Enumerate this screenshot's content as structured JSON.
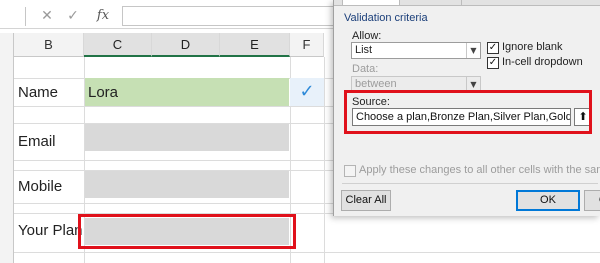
{
  "formula_bar": {
    "cancel_icon": "close-icon",
    "cancel_glyph": "✕",
    "enter_glyph": "✓",
    "fx_label": "fx"
  },
  "columns": [
    "B",
    "C",
    "D",
    "E",
    "F"
  ],
  "rows": {
    "name_label": "Name",
    "name_value": "Lora",
    "email_label": "Email",
    "mobile_label": "Mobile",
    "plan_label": "Your Plan"
  },
  "cell_check_glyph": "✓",
  "dialog": {
    "section_title": "Validation criteria",
    "allow_label": "Allow:",
    "allow_value": "List",
    "data_label": "Data:",
    "data_value": "between",
    "ignore_blank_label": "Ignore blank",
    "ignore_blank_checked": true,
    "in_cell_dropdown_label": "In-cell dropdown",
    "in_cell_dropdown_checked": true,
    "source_label": "Source:",
    "source_value": "Choose a plan,Bronze Plan,Silver Plan,Gold Plan",
    "apply_all_label": "Apply these changes to all other cells with the same settings",
    "clear_all_label": "Clear All",
    "ok_label": "OK",
    "cancel_label": "Cancel"
  },
  "colors": {
    "highlight_red": "#e0111b",
    "name_cell_green": "#c6e0b4",
    "input_cell_gray": "#d9d9d9",
    "excel_green": "#217346"
  }
}
